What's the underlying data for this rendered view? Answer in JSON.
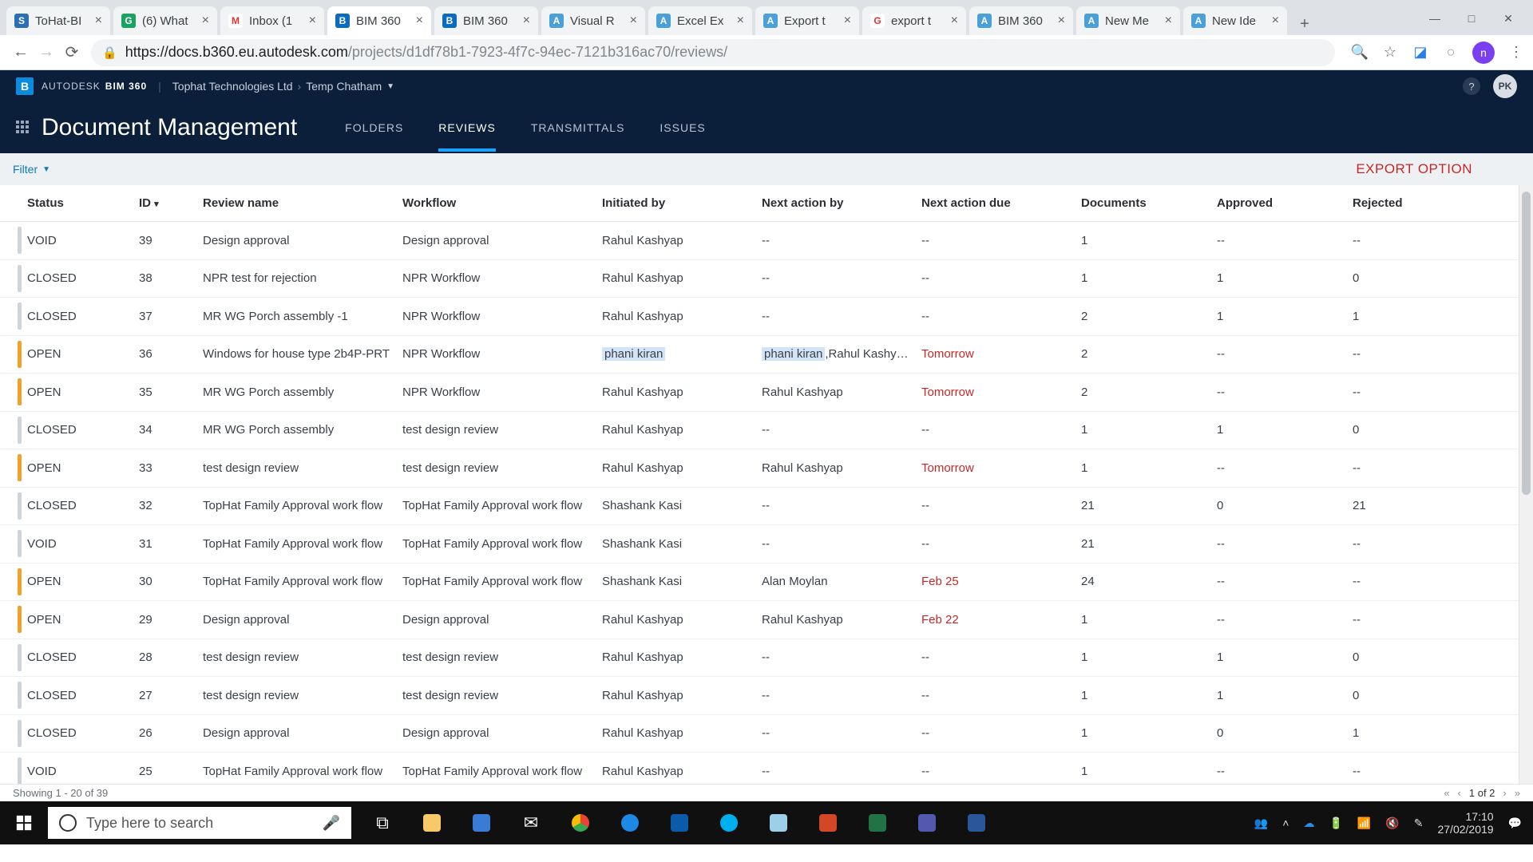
{
  "browser": {
    "tabs": [
      {
        "title": "ToHat-BI",
        "fav_bg": "#2b6fb3",
        "fav_txt": "S"
      },
      {
        "title": "(6) What",
        "fav_bg": "#1aa260",
        "fav_txt": "G"
      },
      {
        "title": "Inbox (1",
        "fav_bg": "#ffffff",
        "fav_txt": "M"
      },
      {
        "title": "BIM 360",
        "fav_bg": "#0b6bbd",
        "fav_txt": "B",
        "active": true
      },
      {
        "title": "BIM 360",
        "fav_bg": "#0b6bbd",
        "fav_txt": "B"
      },
      {
        "title": "Visual R",
        "fav_bg": "#4aa0d8",
        "fav_txt": "A"
      },
      {
        "title": "Excel Ex",
        "fav_bg": "#4aa0d8",
        "fav_txt": "A"
      },
      {
        "title": "Export t",
        "fav_bg": "#4aa0d8",
        "fav_txt": "A"
      },
      {
        "title": "export t",
        "fav_bg": "#ffffff",
        "fav_txt": "G"
      },
      {
        "title": "BIM 360",
        "fav_bg": "#4aa0d8",
        "fav_txt": "A"
      },
      {
        "title": "New Me",
        "fav_bg": "#4aa0d8",
        "fav_txt": "A"
      },
      {
        "title": "New Ide",
        "fav_bg": "#4aa0d8",
        "fav_txt": "A"
      }
    ],
    "url_domain": "https://docs.b360.eu.autodesk.com",
    "url_path": "/projects/d1df78b1-7923-4f7c-94ec-7121b316ac70/reviews/",
    "avatar": "n"
  },
  "app": {
    "brand1": "AUTODESK",
    "brand2": "BIM 360",
    "org": "Tophat Technologies Ltd",
    "project": "Temp Chatham",
    "user": "PK",
    "module": "Document Management",
    "navtabs": [
      "FOLDERS",
      "REVIEWS",
      "TRANSMITTALS",
      "ISSUES"
    ],
    "active_nav": "REVIEWS",
    "filter_label": "Filter",
    "export_label": "EXPORT OPTION"
  },
  "table": {
    "columns": [
      "Status",
      "ID",
      "Review name",
      "Workflow",
      "Initiated by",
      "Next action by",
      "Next action due",
      "Documents",
      "Approved",
      "Rejected"
    ],
    "rows": [
      {
        "status": "VOID",
        "id": "39",
        "name": "Design approval",
        "workflow": "Design approval",
        "init": "Rahul Kashyap",
        "next_by": "--",
        "due": "--",
        "docs": "1",
        "appr": "--",
        "rej": "--"
      },
      {
        "status": "CLOSED",
        "id": "38",
        "name": "NPR test for rejection",
        "workflow": "NPR Workflow",
        "init": "Rahul Kashyap",
        "next_by": "--",
        "due": "--",
        "docs": "1",
        "appr": "1",
        "rej": "0"
      },
      {
        "status": "CLOSED",
        "id": "37",
        "name": "MR WG Porch assembly -1",
        "workflow": "NPR Workflow",
        "init": "Rahul Kashyap",
        "next_by": "--",
        "due": "--",
        "docs": "2",
        "appr": "1",
        "rej": "1"
      },
      {
        "status": "OPEN",
        "id": "36",
        "name": "Windows for house type 2b4P-PRT",
        "workflow": "NPR Workflow",
        "init": "phani kiran",
        "init_hl": true,
        "next_by": "phani kiran,Rahul Kashyap,Ak...",
        "next_hl": "phani kiran",
        "due": "Tomorrow",
        "due_c": true,
        "docs": "2",
        "appr": "--",
        "rej": "--"
      },
      {
        "status": "OPEN",
        "id": "35",
        "name": "MR WG Porch assembly",
        "workflow": "NPR Workflow",
        "init": "Rahul Kashyap",
        "next_by": "Rahul Kashyap",
        "due": "Tomorrow",
        "due_c": true,
        "docs": "2",
        "appr": "--",
        "rej": "--"
      },
      {
        "status": "CLOSED",
        "id": "34",
        "name": "MR WG Porch assembly",
        "workflow": "test design review",
        "init": "Rahul Kashyap",
        "next_by": "--",
        "due": "--",
        "docs": "1",
        "appr": "1",
        "rej": "0"
      },
      {
        "status": "OPEN",
        "id": "33",
        "name": "test design review",
        "workflow": "test design review",
        "init": "Rahul Kashyap",
        "next_by": "Rahul Kashyap",
        "due": "Tomorrow",
        "due_c": true,
        "docs": "1",
        "appr": "--",
        "rej": "--"
      },
      {
        "status": "CLOSED",
        "id": "32",
        "name": "TopHat Family Approval work flow",
        "workflow": "TopHat Family Approval work flow",
        "init": "Shashank Kasi",
        "next_by": "--",
        "due": "--",
        "docs": "21",
        "appr": "0",
        "rej": "21"
      },
      {
        "status": "VOID",
        "id": "31",
        "name": "TopHat Family Approval work flow",
        "workflow": "TopHat Family Approval work flow",
        "init": "Shashank Kasi",
        "next_by": "--",
        "due": "--",
        "docs": "21",
        "appr": "--",
        "rej": "--"
      },
      {
        "status": "OPEN",
        "id": "30",
        "name": "TopHat Family Approval work flow",
        "workflow": "TopHat Family Approval work flow",
        "init": "Shashank Kasi",
        "next_by": "Alan Moylan",
        "due": "Feb 25",
        "due_c": true,
        "docs": "24",
        "appr": "--",
        "rej": "--"
      },
      {
        "status": "OPEN",
        "id": "29",
        "name": "Design approval",
        "workflow": "Design approval",
        "init": "Rahul Kashyap",
        "next_by": "Rahul Kashyap",
        "due": "Feb 22",
        "due_c": true,
        "docs": "1",
        "appr": "--",
        "rej": "--"
      },
      {
        "status": "CLOSED",
        "id": "28",
        "name": "test design review",
        "workflow": "test design review",
        "init": "Rahul Kashyap",
        "next_by": "--",
        "due": "--",
        "docs": "1",
        "appr": "1",
        "rej": "0"
      },
      {
        "status": "CLOSED",
        "id": "27",
        "name": "test design review",
        "workflow": "test design review",
        "init": "Rahul Kashyap",
        "next_by": "--",
        "due": "--",
        "docs": "1",
        "appr": "1",
        "rej": "0"
      },
      {
        "status": "CLOSED",
        "id": "26",
        "name": "Design approval",
        "workflow": "Design approval",
        "init": "Rahul Kashyap",
        "next_by": "--",
        "due": "--",
        "docs": "1",
        "appr": "0",
        "rej": "1"
      },
      {
        "status": "VOID",
        "id": "25",
        "name": "TopHat Family Approval work flow",
        "workflow": "TopHat Family Approval work flow",
        "init": "Rahul Kashyap",
        "next_by": "--",
        "due": "--",
        "docs": "1",
        "appr": "--",
        "rej": "--"
      }
    ],
    "footer": "Showing 1 - 20 of 39",
    "page": "1 of 2"
  },
  "taskbar": {
    "search_placeholder": "Type here to search",
    "time": "17:10",
    "date": "27/02/2019"
  }
}
